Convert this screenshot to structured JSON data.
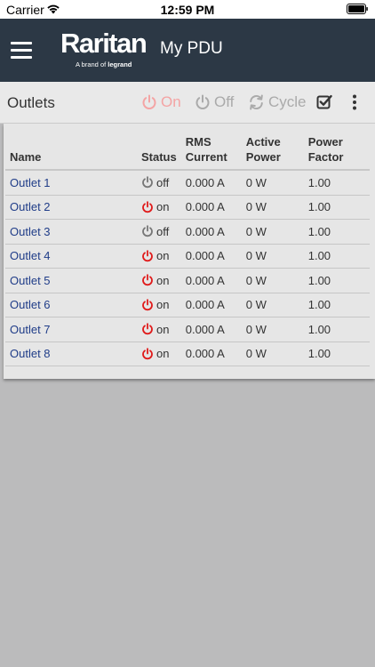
{
  "statusbar": {
    "carrier": "Carrier",
    "time": "12:59 PM"
  },
  "header": {
    "logo_text": "Raritan",
    "logo_sub_prefix": "A brand of",
    "logo_sub_brand": "legrand",
    "title": "My PDU"
  },
  "toolbar": {
    "section_title": "Outlets",
    "on_label": "On",
    "off_label": "Off",
    "cycle_label": "Cycle"
  },
  "table": {
    "headers": {
      "name": "Name",
      "status": "Status",
      "rms_line1": "RMS",
      "rms_line2": "Current",
      "active_line1": "Active",
      "active_line2": "Power",
      "pf_line1": "Power",
      "pf_line2": "Factor"
    },
    "rows": [
      {
        "name": "Outlet 1",
        "status": "off",
        "rms": "0.000 A",
        "power": "0 W",
        "pf": "1.00"
      },
      {
        "name": "Outlet 2",
        "status": "on",
        "rms": "0.000 A",
        "power": "0 W",
        "pf": "1.00"
      },
      {
        "name": "Outlet 3",
        "status": "off",
        "rms": "0.000 A",
        "power": "0 W",
        "pf": "1.00"
      },
      {
        "name": "Outlet 4",
        "status": "on",
        "rms": "0.000 A",
        "power": "0 W",
        "pf": "1.00"
      },
      {
        "name": "Outlet 5",
        "status": "on",
        "rms": "0.000 A",
        "power": "0 W",
        "pf": "1.00"
      },
      {
        "name": "Outlet 6",
        "status": "on",
        "rms": "0.000 A",
        "power": "0 W",
        "pf": "1.00"
      },
      {
        "name": "Outlet 7",
        "status": "on",
        "rms": "0.000 A",
        "power": "0 W",
        "pf": "1.00"
      },
      {
        "name": "Outlet 8",
        "status": "on",
        "rms": "0.000 A",
        "power": "0 W",
        "pf": "1.00"
      }
    ]
  },
  "colors": {
    "header_bg": "#2c3845",
    "on_red": "#e01b1b",
    "off_gray": "#777777",
    "link_blue": "#1f3c88",
    "page_bg": "#bbbbbc"
  },
  "icons": {
    "menu": "hamburger-icon",
    "power_on": "power-icon",
    "power_off": "power-icon",
    "cycle": "cycle-icon",
    "select": "checkbox-icon",
    "more": "more-vertical-icon"
  }
}
